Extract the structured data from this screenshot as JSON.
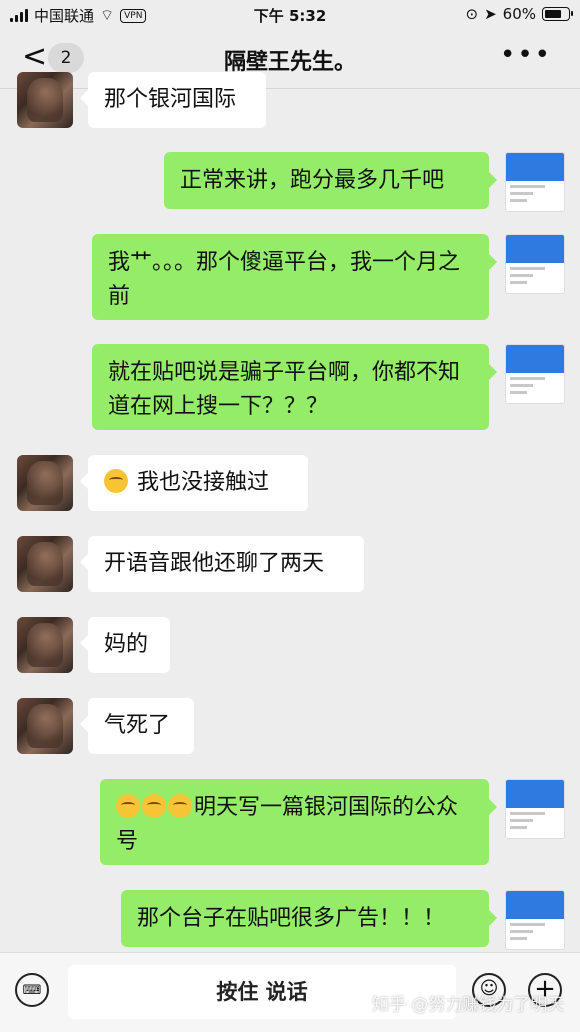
{
  "status_bar": {
    "carrier": "中国联通",
    "vpn": "VPN",
    "time": "下午 5:32",
    "battery": "60%"
  },
  "nav": {
    "back_symbol": "<",
    "unread_count": "2",
    "title": "隔壁王先生。",
    "more_symbol": "•••"
  },
  "messages": [
    {
      "side": "in",
      "text": "那个银河国际"
    },
    {
      "side": "out",
      "text": "正常来讲，跑分最多几千吧"
    },
    {
      "side": "out",
      "text": "我艹。。。那个傻逼平台，我一个月之前"
    },
    {
      "side": "out",
      "text": "就在贴吧说是骗子平台啊，你都不知道在网上搜一下？？？"
    },
    {
      "side": "in",
      "text": "我也没接触过",
      "emoji": "flushed-face"
    },
    {
      "side": "in",
      "text": "开语音跟他还聊了两天"
    },
    {
      "side": "in",
      "text": "妈的"
    },
    {
      "side": "in",
      "text": "气死了"
    },
    {
      "side": "out",
      "text": "明天写一篇银河国际的公众号",
      "emoji": "crying-laughing-face x3"
    },
    {
      "side": "out",
      "text": "那个台子在贴吧很多广告！！！"
    }
  ],
  "input_bar": {
    "hold_to_talk": "按住 说话",
    "keyboard_icon": "keyboard-icon",
    "emoji_icon": "smile-icon",
    "plus_icon": "plus-icon"
  },
  "watermark": "知乎 @努力赚钱为了明天",
  "colors": {
    "outgoing_bubble": "#95ec69",
    "incoming_bubble": "#ffffff",
    "background": "#ededed"
  }
}
